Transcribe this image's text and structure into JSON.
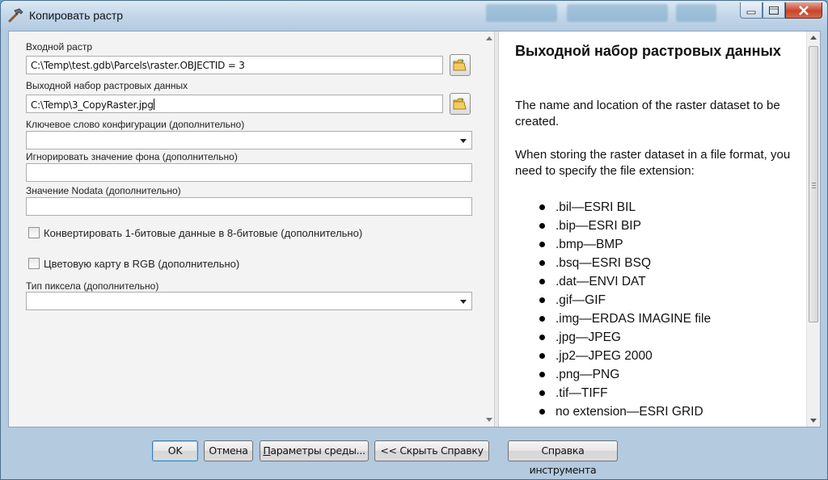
{
  "window": {
    "title": "Копировать растр"
  },
  "form": {
    "input_raster": {
      "label": "Входной растр",
      "value": "C:\\Temp\\test.gdb\\Parcels\\raster.OBJECTID = 3"
    },
    "output_raster": {
      "label": "Выходной набор растровых данных",
      "value": "C:\\Temp\\3_CopyRaster.jpg"
    },
    "config_keyword": {
      "label": "Ключевое слово конфигурации (дополнительно)",
      "value": ""
    },
    "ignore_background": {
      "label": "Игнорировать значение фона (дополнительно)",
      "value": ""
    },
    "nodata": {
      "label": "Значение Nodata (дополнительно)",
      "value": ""
    },
    "convert_1bit": {
      "label": "Конвертировать 1-битовые данные в 8-битовые (дополнительно)",
      "checked": false
    },
    "colormap_rgb": {
      "label": "Цветовую карту в RGB (дополнительно)",
      "checked": false
    },
    "pixel_type": {
      "label": "Тип пиксела (дополнительно)",
      "value": ""
    }
  },
  "help": {
    "title": "Выходной набор растровых данных",
    "paragraph1": "The name and location of the raster dataset to be created.",
    "paragraph2": "When storing the raster dataset in a file format, you need to specify the file extension:",
    "extensions": [
      ".bil—ESRI BIL",
      ".bip—ESRI BIP",
      ".bmp—BMP",
      ".bsq—ESRI BSQ",
      ".dat—ENVI DAT",
      ".gif—GIF",
      ".img—ERDAS IMAGINE file",
      ".jpg—JPEG",
      ".jp2—JPEG 2000",
      ".png—PNG",
      ".tif—TIFF",
      "no extension—ESRI GRID"
    ]
  },
  "buttons": {
    "ok": "OK",
    "cancel": "Отмена",
    "env_prefix": "",
    "env_ul": "П",
    "env_rest": "араметры среды...",
    "hide_help": "<< Скрыть Справку",
    "tool_help": "Справка инструмента"
  },
  "icons": {
    "title": "hammer-icon",
    "browse": "open-folder-icon",
    "dropdown": "chevron-down-icon"
  },
  "colors": {
    "accent": "#3c7fb1",
    "close": "#c7462b",
    "frame": "#b3cadf"
  }
}
